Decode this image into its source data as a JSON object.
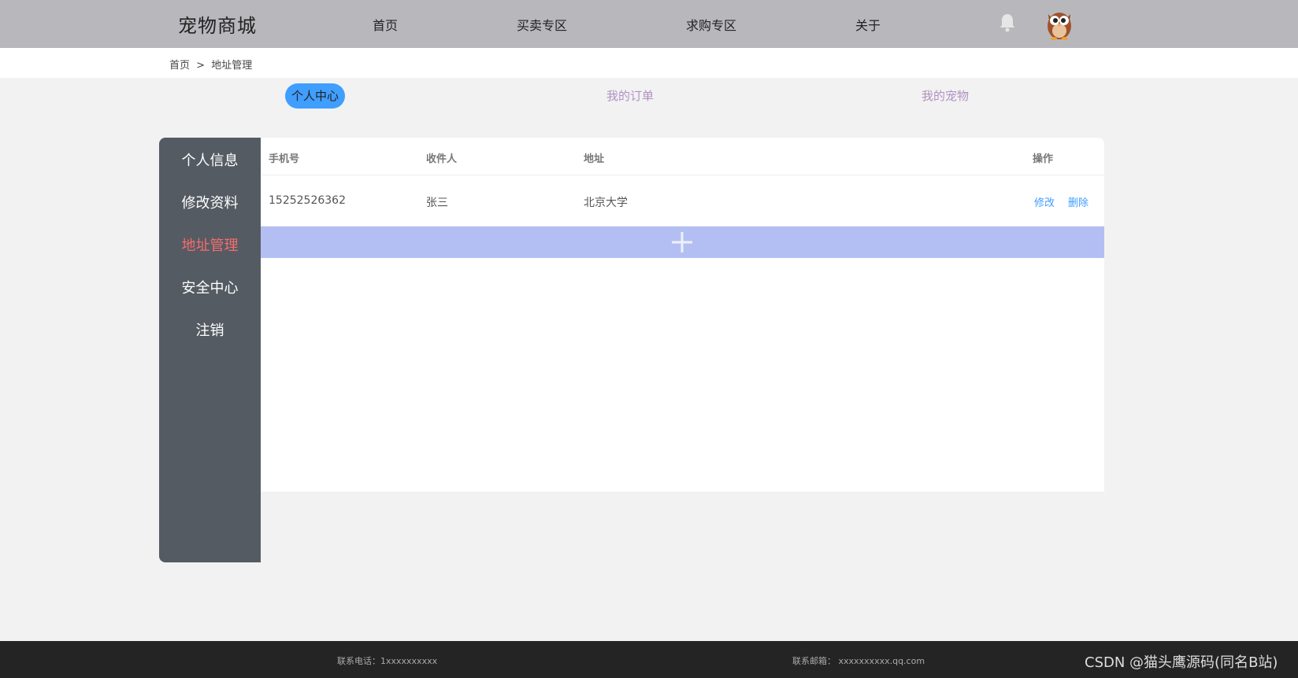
{
  "header": {
    "logo": "宠物商城",
    "nav": [
      "首页",
      "买卖专区",
      "求购专区",
      "关于"
    ]
  },
  "breadcrumb": {
    "home": "首页",
    "separator": ">",
    "current": "地址管理"
  },
  "tabs": [
    {
      "label": "个人中心",
      "active": true
    },
    {
      "label": "我的订单",
      "active": false
    },
    {
      "label": "我的宠物",
      "active": false
    }
  ],
  "sidebar": {
    "items": [
      {
        "label": "个人信息",
        "active": false
      },
      {
        "label": "修改资料",
        "active": false
      },
      {
        "label": "地址管理",
        "active": true
      },
      {
        "label": "安全中心",
        "active": false
      },
      {
        "label": "注销",
        "active": false
      }
    ]
  },
  "table": {
    "headers": [
      "手机号",
      "收件人",
      "地址",
      "操作"
    ],
    "rows": [
      {
        "phone": "15252526362",
        "recipient": "张三",
        "address": "北京大学",
        "edit": "修改",
        "delete": "删除"
      }
    ]
  },
  "footer": {
    "phone": "联系电话：1xxxxxxxxxx",
    "email": "联系邮箱： xxxxxxxxxx.qq.com",
    "watermark": "CSDN @猫头鹰源码(同名B站)"
  },
  "icons": {
    "bell": "bell-icon",
    "avatar": "owl-avatar",
    "add": "plus-icon"
  },
  "colors": {
    "header_bg": "#b8b8bc",
    "tab_active": "#409eff",
    "sidebar_bg": "#555b63",
    "sidebar_active": "#f56c6c",
    "add_bar": "#b3bff2",
    "link": "#409eff",
    "footer_bg": "#242424"
  }
}
